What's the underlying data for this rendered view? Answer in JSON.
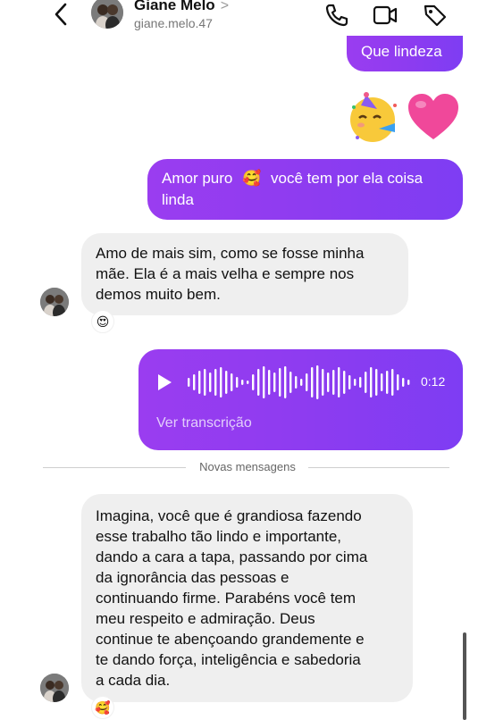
{
  "header": {
    "name": "Giane Melo",
    "chevron": ">",
    "handle": "giane.melo.47",
    "icons": [
      "back-chevron-icon",
      "phone-icon",
      "video-camera-icon",
      "tag-icon"
    ]
  },
  "messages": {
    "out_1": "Que lindeza",
    "out_emojis": [
      "🥳",
      "💗"
    ],
    "out_2_line1_a": "Amor puro",
    "out_2_emoji": "🥰",
    "out_2_line1_b": "você tem por ela coisa",
    "out_2_line2": "linda",
    "in_1_lines": [
      "Amo de mais sim, como se fosse minha",
      "mãe.  Ela é a mais velha e sempre nos",
      "demos muito bem."
    ],
    "in_1_reaction": "😍",
    "voice": {
      "duration": "0:12",
      "transcript_link": "Ver transcrição"
    },
    "divider": "Novas mensagens",
    "in_2_lines": [
      "Imagina, você que é grandiosa fazendo",
      "esse trabalho tão lindo e importante,",
      "dando a cara a tapa, passando por cima",
      "da ignorância das pessoas e",
      "continuando firme. Parabéns você tem",
      "meu respeito e admiração. Deus",
      "continue te abençoando grandemente e",
      "te dando força, inteligência e sabedoria",
      "a cada dia."
    ],
    "in_2_reaction": "🥰"
  },
  "colors": {
    "accent": "#8f3cf0",
    "incoming": "#efefef"
  }
}
